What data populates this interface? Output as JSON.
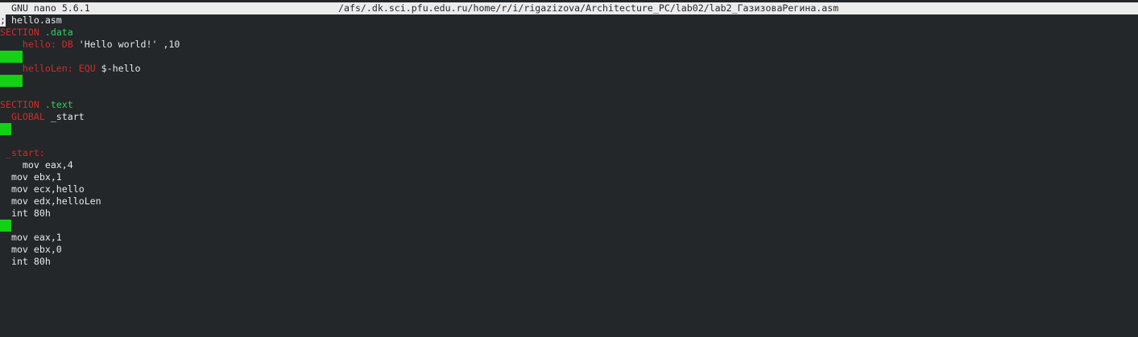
{
  "titlebar": {
    "version": "GNU nano 5.6.1",
    "path": "/afs/.dk.sci.pfu.edu.ru/home/r/i/rigazizova/Architecture_PC/lab02/lab2_ГазизоваРегина.asm"
  },
  "colors": {
    "background": "#232729",
    "text": "#e8e8e8",
    "keyword_red": "#d22a2a",
    "keyword_green": "#2fd15e",
    "trailing_whitespace": "#13d113",
    "titlebar_bg": "#ececec"
  },
  "editor": {
    "lines": [
      {
        "cursor": ";",
        "segments": [
          {
            "t": " hello.asm",
            "c": "default"
          }
        ]
      },
      {
        "segments": [
          {
            "t": "SECTION",
            "c": "red"
          },
          {
            "t": " .data",
            "c": "green"
          }
        ]
      },
      {
        "segments": [
          {
            "t": "    hello:",
            "c": "red"
          },
          {
            "t": " DB",
            "c": "red"
          },
          {
            "t": " 'Hello world!' ,10",
            "c": "default"
          }
        ]
      },
      {
        "ws": 4,
        "segments": []
      },
      {
        "segments": [
          {
            "t": "    helloLen:",
            "c": "red"
          },
          {
            "t": " EQU",
            "c": "red"
          },
          {
            "t": " $-hello",
            "c": "default"
          }
        ]
      },
      {
        "ws": 4,
        "segments": []
      },
      {
        "segments": []
      },
      {
        "segments": [
          {
            "t": "SECTION",
            "c": "red"
          },
          {
            "t": " .text",
            "c": "green"
          }
        ]
      },
      {
        "segments": [
          {
            "t": "  GLOBAL",
            "c": "red"
          },
          {
            "t": " _start",
            "c": "default"
          }
        ]
      },
      {
        "ws": 2,
        "segments": []
      },
      {
        "segments": []
      },
      {
        "segments": [
          {
            "t": " _start:",
            "c": "red"
          }
        ]
      },
      {
        "segments": [
          {
            "t": "    mov eax,4",
            "c": "default"
          }
        ]
      },
      {
        "segments": [
          {
            "t": "  mov ebx,1",
            "c": "default"
          }
        ]
      },
      {
        "segments": [
          {
            "t": "  mov ecx,hello",
            "c": "default"
          }
        ]
      },
      {
        "segments": [
          {
            "t": "  mov edx,helloLen",
            "c": "default"
          }
        ]
      },
      {
        "segments": [
          {
            "t": "  int 80h",
            "c": "default"
          }
        ]
      },
      {
        "ws": 2,
        "segments": []
      },
      {
        "segments": [
          {
            "t": "  mov eax,1",
            "c": "default"
          }
        ]
      },
      {
        "segments": [
          {
            "t": "  mov ebx,0",
            "c": "default"
          }
        ]
      },
      {
        "segments": [
          {
            "t": "  int 80h",
            "c": "default"
          }
        ]
      }
    ]
  }
}
